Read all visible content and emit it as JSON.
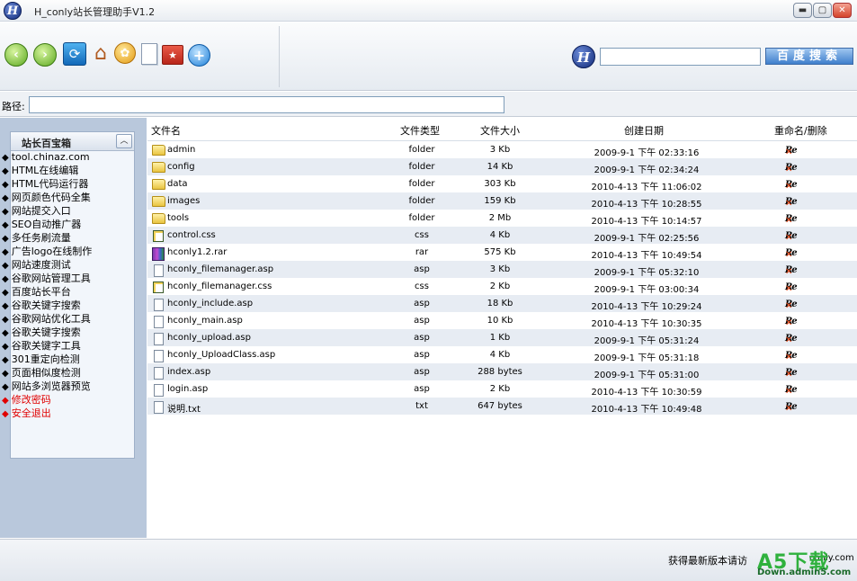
{
  "window": {
    "title": "H_conly站长管理助手V1.2",
    "minimize": "▬",
    "maximize": "▢",
    "close": "✕",
    "app_icon_letter": "H"
  },
  "toolbar": {
    "back": "‹",
    "forward": "›",
    "refresh": "⟳",
    "home": "⌂",
    "add": "+",
    "tag": "✿",
    "favorite": "★",
    "search_logo_letter": "H",
    "search_value": "",
    "search_button": "百度搜索"
  },
  "path": {
    "label": "路径:",
    "value": ""
  },
  "sidebar": {
    "title": "站长百宝箱",
    "collapse": "︿",
    "items": [
      {
        "label": "tool.chinaz.com"
      },
      {
        "label": "HTML在线编辑"
      },
      {
        "label": "HTML代码运行器"
      },
      {
        "label": "网页颜色代码全集"
      },
      {
        "label": "网站提交入口"
      },
      {
        "label": "SEO自动推广器"
      },
      {
        "label": "多任务刷流量"
      },
      {
        "label": "广告logo在线制作"
      },
      {
        "label": "网站速度测试"
      },
      {
        "label": "谷歌网站管理工具"
      },
      {
        "label": "百度站长平台"
      },
      {
        "label": "谷歌关键字搜索"
      },
      {
        "label": "谷歌网站优化工具"
      },
      {
        "label": "谷歌关键字搜索"
      },
      {
        "label": "谷歌关键字工具"
      },
      {
        "label": "301重定向检测"
      },
      {
        "label": "页面相似度检测"
      },
      {
        "label": "网站多浏览器预览"
      },
      {
        "label": "修改密码"
      },
      {
        "label": "安全退出"
      }
    ]
  },
  "files": {
    "headers": {
      "name": "文件名",
      "type": "文件类型",
      "size": "文件大小",
      "date": "创建日期",
      "actions": "重命名/删除"
    },
    "rename_label": "Re",
    "delete_label": "✕",
    "rows": [
      {
        "name": "admin",
        "type": "folder",
        "size": "3 Kb",
        "date": "2009-9-1  下午  02:33:16",
        "icon": "folder"
      },
      {
        "name": "config",
        "type": "folder",
        "size": "14 Kb",
        "date": "2009-9-1  下午  02:34:24",
        "icon": "folder"
      },
      {
        "name": "data",
        "type": "folder",
        "size": "303 Kb",
        "date": "2010-4-13  下午  11:06:02",
        "icon": "folder"
      },
      {
        "name": "images",
        "type": "folder",
        "size": "159 Kb",
        "date": "2010-4-13  下午  10:28:55",
        "icon": "folder"
      },
      {
        "name": "tools",
        "type": "folder",
        "size": "2 Mb",
        "date": "2010-4-13  下午  10:14:57",
        "icon": "folder"
      },
      {
        "name": "control.css",
        "type": "css",
        "size": "4 Kb",
        "date": "2009-9-1  下午  02:25:56",
        "icon": "css"
      },
      {
        "name": "hconly1.2.rar",
        "type": "rar",
        "size": "575 Kb",
        "date": "2010-4-13  下午  10:49:54",
        "icon": "rar"
      },
      {
        "name": "hconly_filemanager.asp",
        "type": "asp",
        "size": "3 Kb",
        "date": "2009-9-1  下午  05:32:10",
        "icon": "file"
      },
      {
        "name": "hconly_filemanager.css",
        "type": "css",
        "size": "2 Kb",
        "date": "2009-9-1  下午  03:00:34",
        "icon": "css"
      },
      {
        "name": "hconly_include.asp",
        "type": "asp",
        "size": "18 Kb",
        "date": "2010-4-13  下午  10:29:24",
        "icon": "file"
      },
      {
        "name": "hconly_main.asp",
        "type": "asp",
        "size": "10 Kb",
        "date": "2010-4-13  下午  10:30:35",
        "icon": "file"
      },
      {
        "name": "hconly_upload.asp",
        "type": "asp",
        "size": "1 Kb",
        "date": "2009-9-1  下午  05:31:24",
        "icon": "file"
      },
      {
        "name": "hconly_UploadClass.asp",
        "type": "asp",
        "size": "4 Kb",
        "date": "2009-9-1  下午  05:31:18",
        "icon": "file"
      },
      {
        "name": "index.asp",
        "type": "asp",
        "size": "288 bytes",
        "date": "2009-9-1  下午  05:31:00",
        "icon": "file"
      },
      {
        "name": "login.asp",
        "type": "asp",
        "size": "2 Kb",
        "date": "2010-4-13  下午  10:30:59",
        "icon": "file"
      },
      {
        "name": "说明.txt",
        "type": "txt",
        "size": "647 bytes",
        "date": "2010-4-13  下午  10:49:48",
        "icon": "file"
      }
    ]
  },
  "status": {
    "visit_text": "获得最新版本请访",
    "site": "conly.com"
  },
  "watermark": {
    "main": "A5下载",
    "sub": "Down.admin5.com"
  }
}
